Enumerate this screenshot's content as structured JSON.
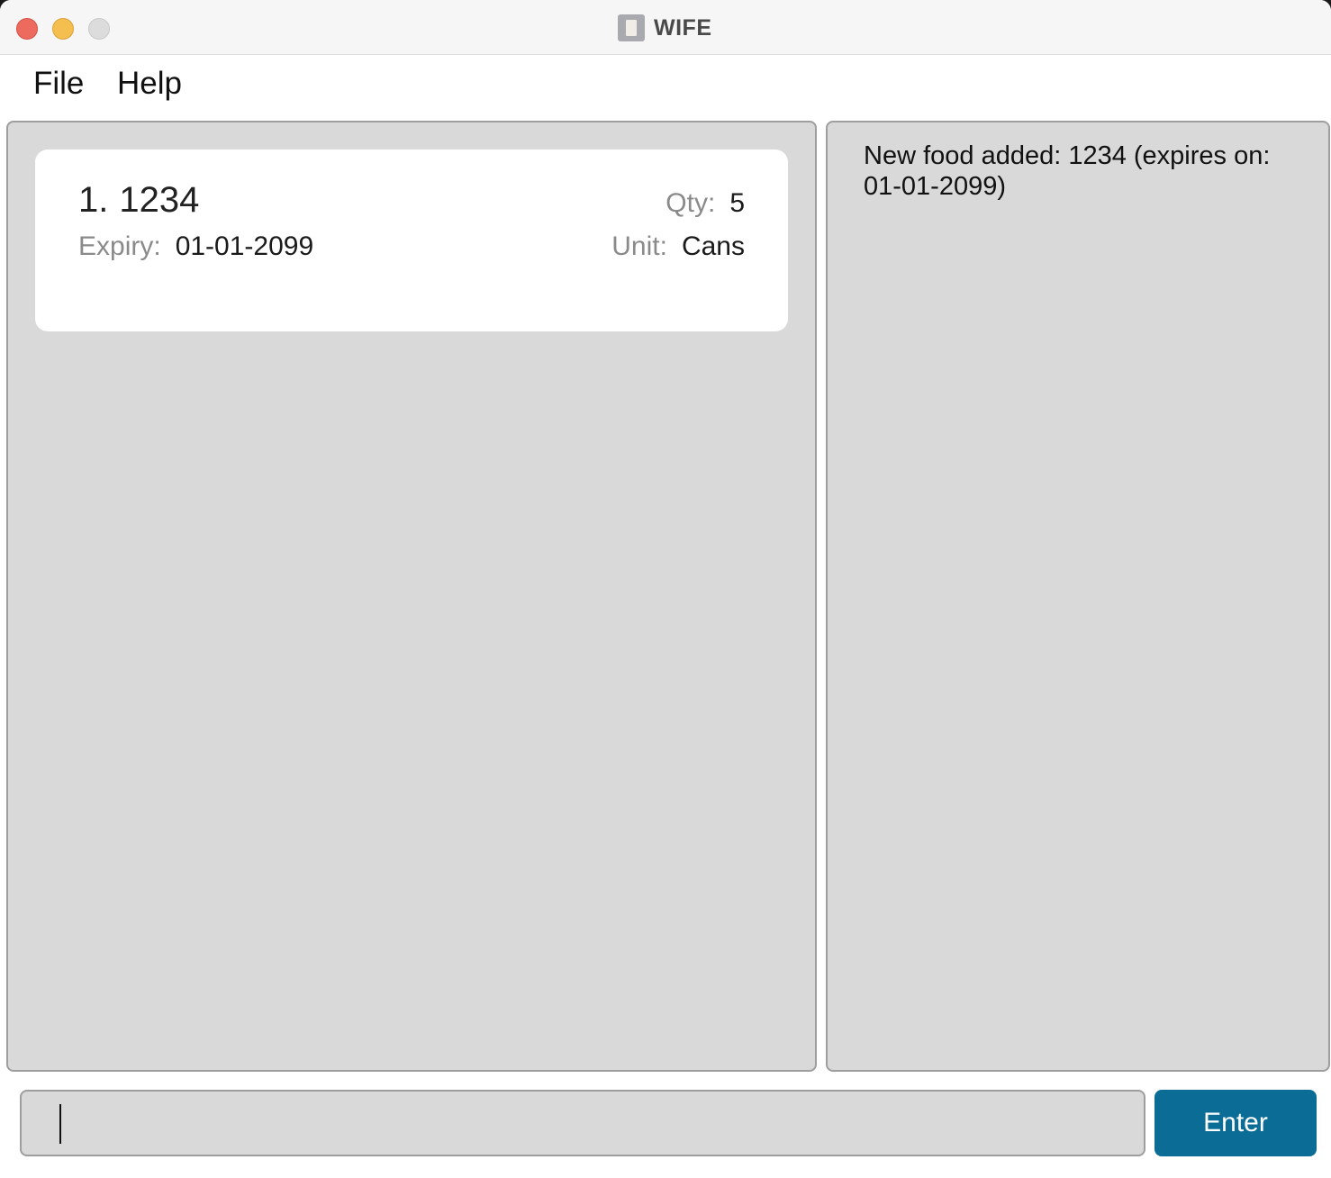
{
  "window": {
    "title": "WIFE",
    "app_icon": "wife-app-icon"
  },
  "menu": {
    "items": [
      "File",
      "Help"
    ]
  },
  "food_list": {
    "items": [
      {
        "index": "1.",
        "name": "1234",
        "qty_label": "Qty:",
        "qty": "5",
        "expiry_label": "Expiry:",
        "expiry": "01-01-2099",
        "unit_label": "Unit:",
        "unit": "Cans"
      }
    ]
  },
  "result_display": {
    "message": "New food added: 1234 (expires on: 01-01-2099)"
  },
  "command_box": {
    "value": "",
    "button_label": "Enter"
  },
  "colors": {
    "panel_bg": "#d9d9d9",
    "card_bg": "#ffffff",
    "enter_button": "#0b6d96",
    "close": "#ed6a5e",
    "minimize": "#f4bf4f",
    "maximize": "#dcdcdc"
  }
}
